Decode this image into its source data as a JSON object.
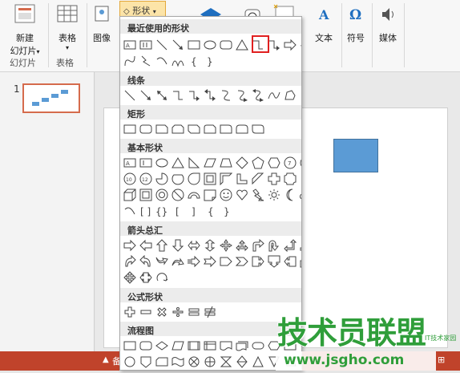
{
  "ribbon": {
    "new_slide": {
      "line1": "新建",
      "line2": "幻灯片",
      "arrow": "▾"
    },
    "table": {
      "label": "表格",
      "arrow": "▾"
    },
    "image": {
      "label": "图像"
    },
    "shapes": {
      "label": "形状",
      "arrow": "▾"
    },
    "text": {
      "label": "文本"
    },
    "symbol": {
      "label": "符号"
    },
    "media": {
      "label": "媒体"
    },
    "groups": {
      "slides": "幻灯片",
      "tables": "表格"
    }
  },
  "thumb": {
    "number": "1"
  },
  "status": {
    "text": "备"
  },
  "dropdown": {
    "recent": "最近使用的形状",
    "lines": "线条",
    "rect": "矩形",
    "basic": "基本形状",
    "arrows": "箭头总汇",
    "equation": "公式形状",
    "flowchart": "流程图"
  },
  "watermark": {
    "text": "技术员联盟",
    "url": "www.jsgho.com",
    "small": "IT技术家园"
  }
}
